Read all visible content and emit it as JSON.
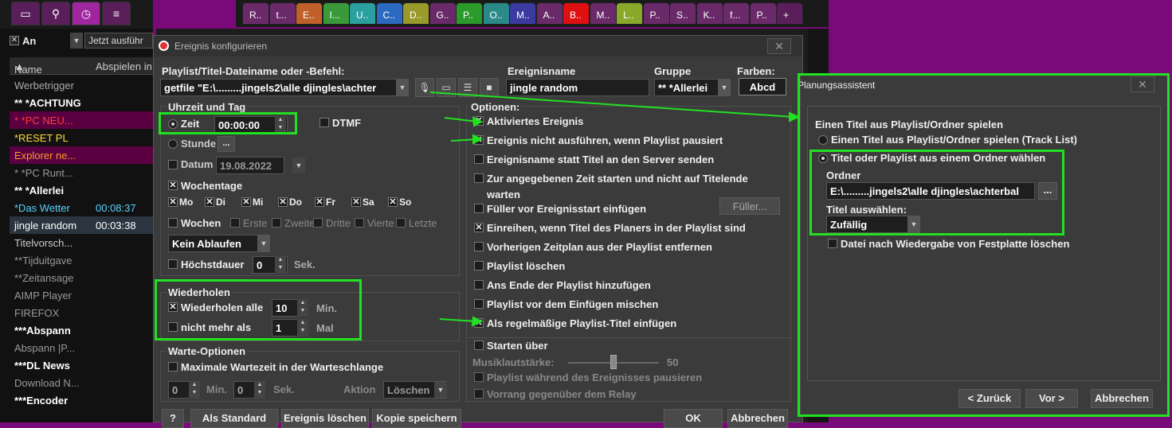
{
  "left": {
    "filter_label": "An",
    "filter_dropdown": "Jetzt ausführ",
    "col_name": "Name",
    "col_play": "Abspielen in",
    "rows": [
      {
        "name": "Werbetrigger",
        "dur": "",
        "color": "#aaaaaa",
        "bg": "#111111",
        "bold": false
      },
      {
        "name": "** *ACHTUNG",
        "dur": "",
        "color": "#ffffff",
        "bg": "#111111",
        "bold": true
      },
      {
        "name": "  * *PC NEU...",
        "dur": "",
        "color": "#ff3b3b",
        "bg": "#5a0040",
        "bold": false
      },
      {
        "name": "*RESET PL",
        "dur": "",
        "color": "#ffdb3b",
        "bg": "#111111",
        "bold": false
      },
      {
        "name": "Explorer ne...",
        "dur": "",
        "color": "#ff9a2b",
        "bg": "#5a0040",
        "bold": false
      },
      {
        "name": "  * *PC Runt...",
        "dur": "",
        "color": "#999999",
        "bg": "#111111",
        "bold": false
      },
      {
        "name": "** *Allerlei",
        "dur": "",
        "color": "#ffffff",
        "bg": "#111111",
        "bold": true
      },
      {
        "name": "*Das Wetter",
        "dur": "00:08:37",
        "color": "#5ad2ff",
        "bg": "#111111",
        "bold": false
      },
      {
        "name": "jingle random",
        "dur": "00:03:38",
        "color": "#ffffff",
        "bg": "#2a3540",
        "bold": false
      },
      {
        "name": "Titelvorsch...",
        "dur": "",
        "color": "#cccccc",
        "bg": "#111111",
        "bold": false
      },
      {
        "name": "**Tijduitgave",
        "dur": "",
        "color": "#999999",
        "bg": "#111111",
        "bold": false
      },
      {
        "name": "**Zeitansage",
        "dur": "",
        "color": "#999999",
        "bg": "#111111",
        "bold": false
      },
      {
        "name": "AIMP Player",
        "dur": "",
        "color": "#999999",
        "bg": "#111111",
        "bold": false
      },
      {
        "name": "FIREFOX",
        "dur": "",
        "color": "#999999",
        "bg": "#111111",
        "bold": false
      },
      {
        "name": "***Abspann",
        "dur": "",
        "color": "#ffffff",
        "bg": "#111111",
        "bold": true
      },
      {
        "name": "Abspann |P...",
        "dur": "",
        "color": "#999999",
        "bg": "#111111",
        "bold": false
      },
      {
        "name": "***DL News",
        "dur": "",
        "color": "#ffffff",
        "bg": "#111111",
        "bold": true
      },
      {
        "name": "Download N...",
        "dur": "",
        "color": "#999999",
        "bg": "#111111",
        "bold": false
      },
      {
        "name": "***Encoder",
        "dur": "",
        "color": "#ffffff",
        "bg": "#111111",
        "bold": true
      }
    ]
  },
  "tabs": [
    {
      "label": "R..",
      "color": "#6a2a6a"
    },
    {
      "label": "t...",
      "color": "#6a2a6a"
    },
    {
      "label": "E..",
      "color": "#c0602a"
    },
    {
      "label": "I...",
      "color": "#3a9a3a"
    },
    {
      "label": "U..",
      "color": "#2aa0a0"
    },
    {
      "label": "C..",
      "color": "#2a6ac0"
    },
    {
      "label": "D..",
      "color": "#9a9a2a"
    },
    {
      "label": "G..",
      "color": "#6a2a6a"
    },
    {
      "label": "P..",
      "color": "#2a9a2a"
    },
    {
      "label": "O..",
      "color": "#2a8a8a"
    },
    {
      "label": "M..",
      "color": "#3a3aa0"
    },
    {
      "label": "A..",
      "color": "#6a2a6a"
    },
    {
      "label": "B..",
      "color": "#e01010"
    },
    {
      "label": "M..",
      "color": "#6a2a6a"
    },
    {
      "label": "L..",
      "color": "#8aa82a"
    },
    {
      "label": "P..",
      "color": "#6a2a6a"
    },
    {
      "label": "S..",
      "color": "#6a2a6a"
    },
    {
      "label": "K..",
      "color": "#6a2a6a"
    },
    {
      "label": "f...",
      "color": "#6a2a6a"
    },
    {
      "label": "P..",
      "color": "#6a2a6a"
    },
    {
      "label": "+",
      "color": "#5a1f5a"
    }
  ],
  "dialog": {
    "title": "Ereignis konfigurieren",
    "playlist_label": "Playlist/Titel-Dateiname oder -Befehl:",
    "playlist_value": "getfile \"E:\\.........jingels2\\alle djingles\\achter",
    "name_label": "Ereignisname",
    "name_value": "jingle random",
    "group_label": "Gruppe",
    "group_value": "** *Allerlei",
    "colors_label": "Farben:",
    "colors_value": "Abcd",
    "time_section": "Uhrzeit und Tag",
    "zeit_label": "Zeit",
    "zeit_value": "00:00:00",
    "dtmf_label": "DTMF",
    "stunde_label": "Stunde",
    "datum_label": "Datum",
    "datum_value": "19.08.2022",
    "wochentage_label": "Wochentage",
    "days": [
      "Mo",
      "Di",
      "Mi",
      "Do",
      "Fr",
      "Sa",
      "So"
    ],
    "wochen_label": "Wochen",
    "weeks": [
      "Erste",
      "Zweite",
      "Dritte",
      "Vierte",
      "Letzte"
    ],
    "ablaufen_value": "Kein Ablaufen",
    "hoechst_label": "Höchstdauer",
    "hoechst_value": "0",
    "hoechst_unit": "Sek.",
    "repeat_section": "Wiederholen",
    "repeat_all_label": "Wiederholen alle",
    "repeat_all_value": "10",
    "repeat_all_unit": "Min.",
    "not_more_label": "nicht mehr als",
    "not_more_value": "1",
    "not_more_unit": "Mal",
    "wait_section": "Warte-Optionen",
    "wait_max_label": "Maximale Wartezeit in der Warteschlange",
    "wait_min_value": "0",
    "wait_min_unit": "Min.",
    "wait_sec_value": "0",
    "wait_sec_unit": "Sek.",
    "action_label": "Aktion",
    "action_value": "Löschen",
    "options_section": "Optionen:",
    "options": [
      {
        "label": "Aktiviertes Ereignis",
        "checked": true,
        "dim": false
      },
      {
        "label": "Ereignis nicht ausführen, wenn Playlist pausiert",
        "checked": true,
        "dim": false
      },
      {
        "label": "Ereignisname statt Titel an den Server senden",
        "checked": false,
        "dim": false
      },
      {
        "label": "Zur angegebenen Zeit starten und nicht auf Titelende",
        "checked": false,
        "dim": false
      },
      {
        "label": "Füller vor Ereignisstart einfügen",
        "checked": false,
        "dim": false
      },
      {
        "label": "Einreihen, wenn Titel des Planers in der Playlist sind",
        "checked": true,
        "dim": false
      },
      {
        "label": "Vorherigen Zeitplan aus der Playlist entfernen",
        "checked": false,
        "dim": false
      },
      {
        "label": "Playlist löschen",
        "checked": false,
        "dim": false
      },
      {
        "label": "Ans Ende der Playlist hinzufügen",
        "checked": false,
        "dim": false
      },
      {
        "label": "Playlist vor dem Einfügen mischen",
        "checked": false,
        "dim": false
      },
      {
        "label": "Als regelmäßige Playlist-Titel einfügen",
        "checked": true,
        "dim": false
      }
    ],
    "warten_label": "warten",
    "fueller_button": "Füller...",
    "start_over_label": "Starten über",
    "music_vol_label": "Musiklautstärke:",
    "music_vol_value": "50",
    "music_vol_fraction": 0.5,
    "pause_label": "Playlist während des Ereignisses pausieren",
    "relay_label": "Vorrang gegenüber dem Relay",
    "btn_help": "?",
    "btn_default": "Als Standard",
    "btn_delete": "Ereignis löschen",
    "btn_copy": "Kopie speichern",
    "btn_ok": "OK",
    "btn_cancel": "Abbrechen"
  },
  "planer": {
    "title": "Planungsassistent",
    "heading": "Einen Titel aus Playlist/Ordner spielen",
    "radio1": "Einen Titel aus Playlist/Ordner spielen (Track List)",
    "radio2": "Titel oder Playlist aus einem Ordner wählen",
    "folder_label": "Ordner",
    "folder_value": "E:\\.........jingels2\\alle djingles\\achterbal",
    "browse": "...",
    "select_label": "Titel auswählen:",
    "select_value": "Zufällig",
    "delete_label": "Datei nach Wiedergabe von Festplatte löschen",
    "btn_back": "< Zurück",
    "btn_next": "Vor >",
    "btn_cancel": "Abbrechen"
  },
  "colors": {
    "highlight": "#22e022",
    "accent": "#a0269f"
  }
}
